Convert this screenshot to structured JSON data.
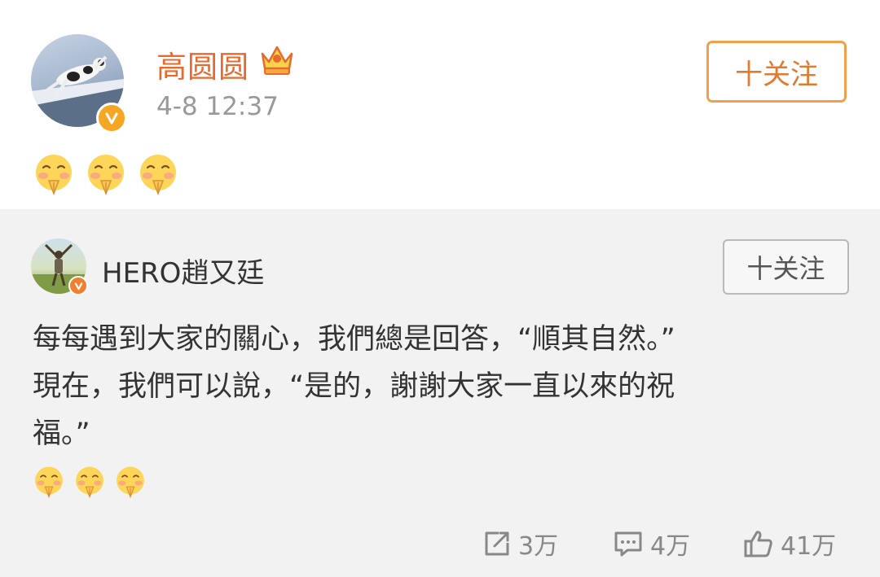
{
  "post": {
    "username": "高圆圆",
    "timestamp": "4-8 12:37",
    "follow_label": "十关注",
    "emoji_icons": [
      "praying-blush-emoji",
      "praying-blush-emoji",
      "praying-blush-emoji"
    ]
  },
  "repost": {
    "username": "HERO趙又廷",
    "follow_label": "十关注",
    "text_lines": [
      "每每遇到大家的關心，我們總是回答，“順其自然。”",
      "現在，我們可以說，“是的，謝謝大家一直以來的祝",
      "福。”"
    ],
    "emoji_icons": [
      "praying-blush-emoji",
      "praying-blush-emoji",
      "praying-blush-emoji"
    ]
  },
  "actions": {
    "repost_count": "3万",
    "comment_count": "4万",
    "like_count": "41万"
  },
  "colors": {
    "username_orange": "#e8692c",
    "follow_border": "#f0a04b",
    "verified_badge": "#f5a623",
    "repost_bg": "#f2f2f2",
    "meta_gray": "#999999"
  }
}
